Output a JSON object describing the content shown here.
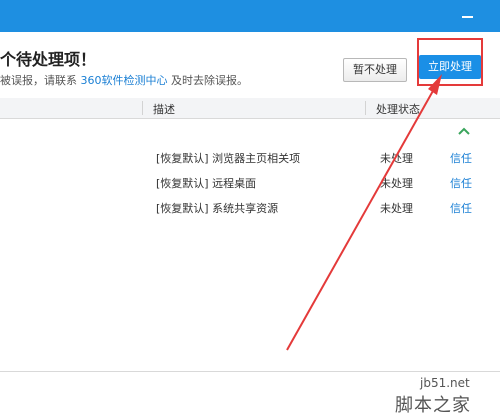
{
  "window": {
    "minimize_icon": "minimize-icon",
    "title_bar_color": "#1e8fe1"
  },
  "header": {
    "title": "个待处理项！",
    "subtitle_prefix": "被误报，请联系",
    "subtitle_link": "360软件检测中心",
    "subtitle_suffix": "及时去除误报。",
    "btn_later": "暂不处理",
    "btn_now": "立即处理"
  },
  "columns": {
    "description": "描述",
    "status": "处理状态"
  },
  "collapse_icon": "chevron-up-icon",
  "rows": [
    {
      "description": "[恢复默认] 浏览器主页相关项",
      "status": "未处理",
      "action": "信任"
    },
    {
      "description": "[恢复默认] 远程桌面",
      "status": "未处理",
      "action": "信任"
    },
    {
      "description": "[恢复默认] 系统共享资源",
      "status": "未处理",
      "action": "信任"
    }
  ],
  "watermark": {
    "url": "jb51.net",
    "name": "脚本之家"
  },
  "colors": {
    "accent": "#1a8fe6",
    "link": "#1a7fd4",
    "annotation": "#e43a3a",
    "collapse_icon": "#3aa55c"
  }
}
